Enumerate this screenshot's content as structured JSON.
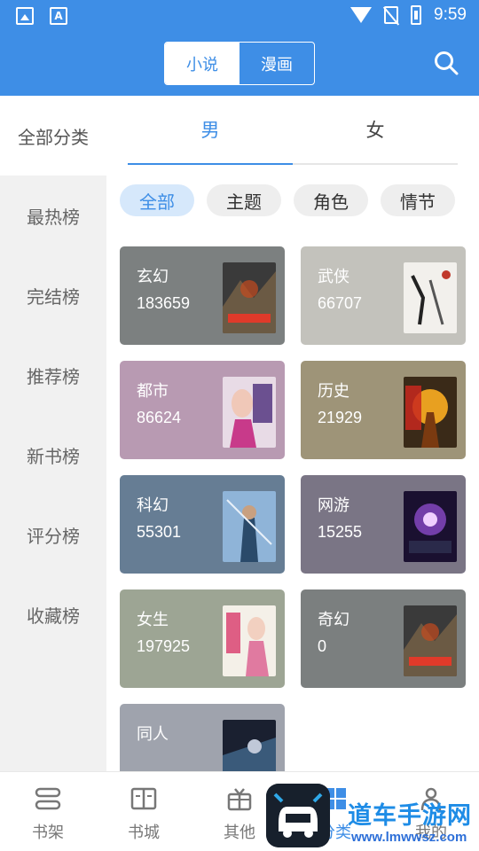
{
  "status_bar": {
    "time": "9:59"
  },
  "header": {
    "segments": [
      {
        "label": "小说",
        "active": true
      },
      {
        "label": "漫画",
        "active": false
      }
    ]
  },
  "sidebar": {
    "items": [
      "全部分类",
      "最热榜",
      "完结榜",
      "推荐榜",
      "新书榜",
      "评分榜",
      "收藏榜"
    ]
  },
  "gender_tabs": [
    {
      "label": "男",
      "active": true
    },
    {
      "label": "女",
      "active": false
    }
  ],
  "filter_chips": [
    {
      "label": "全部",
      "active": true
    },
    {
      "label": "主题",
      "active": false
    },
    {
      "label": "角色",
      "active": false
    },
    {
      "label": "情节",
      "active": false
    }
  ],
  "categories": [
    {
      "name": "玄幻",
      "count": "183659",
      "bg": "#7c8080"
    },
    {
      "name": "武侠",
      "count": "66707",
      "bg": "#c3c2bc"
    },
    {
      "name": "都市",
      "count": "86624",
      "bg": "#b89ab2"
    },
    {
      "name": "历史",
      "count": "21929",
      "bg": "#9e9478"
    },
    {
      "name": "科幻",
      "count": "55301",
      "bg": "#667d94"
    },
    {
      "name": "网游",
      "count": "15255",
      "bg": "#7a7585"
    },
    {
      "name": "女生",
      "count": "197925",
      "bg": "#9da594"
    },
    {
      "name": "奇幻",
      "count": "0",
      "bg": "#7b7f7f"
    },
    {
      "name": "同人",
      "count": "",
      "bg": "#9fa3ad"
    }
  ],
  "bottom_nav": [
    {
      "label": "书架",
      "icon": "bookshelf-icon",
      "active": false
    },
    {
      "label": "书城",
      "icon": "book-icon",
      "active": false
    },
    {
      "label": "其他",
      "icon": "gift-icon",
      "active": false
    },
    {
      "label": "分类",
      "icon": "category-icon",
      "active": true
    },
    {
      "label": "我的",
      "icon": "user-icon",
      "active": false
    }
  ],
  "watermark": {
    "title": "道车手游网",
    "url": "www.lmwwsz.com"
  },
  "colors": {
    "accent": "#3e8ee6"
  }
}
